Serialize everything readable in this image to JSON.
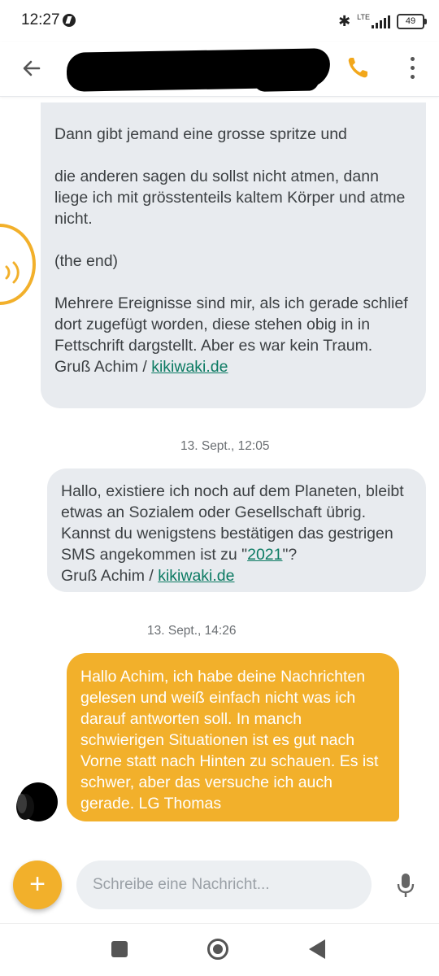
{
  "status_bar": {
    "time": "12:27",
    "network": "LTE",
    "battery": "49",
    "icons": [
      "bolt-icon",
      "bluetooth-icon",
      "signal-icon",
      "battery-icon"
    ]
  },
  "app_bar": {
    "icons": [
      "back-arrow-icon",
      "phone-icon",
      "more-vert-icon"
    ],
    "accent_color": "#f2b02b"
  },
  "messages": [
    {
      "direction": "incoming",
      "paragraphs": [
        {
          "text": "Dann gibt jemand eine grosse spritze und"
        },
        {
          "text": "die anderen sagen du sollst nicht atmen, dann liege ich mit grösstenteils kaltem Körper und atme nicht."
        },
        {
          "text": "(the end)"
        },
        {
          "text": "Mehrere Ereignisse sind mir, als ich gerade schlief dort zugefügt worden, diese stehen obig in in Fettschrift dargstellt. Aber es war kein Traum."
        }
      ],
      "signature_prefix": "Gruß Achim / ",
      "signature_link": "kikiwaki.de"
    },
    {
      "direction": "incoming",
      "timestamp": "13. Sept., 12:05",
      "text_before_link": "Hallo, existiere ich noch auf dem Planeten, bleibt etwas an Sozialem oder Gesellschaft übrig. Kannst du wenigstens bestätigen das gestrigen SMS angekommen ist zu \"",
      "inline_link": "2021",
      "text_after_link": "\"?",
      "signature_prefix": "Gruß Achim / ",
      "signature_link": "kikiwaki.de"
    },
    {
      "direction": "outgoing",
      "timestamp": "13. Sept., 14:26",
      "text": "Hallo Achim, ich habe deine Nachrichten gelesen und weiß einfach nicht was ich darauf antworten soll. In manch schwierigen Situationen ist es gut nach Vorne statt nach Hinten zu schauen. Es ist schwer, aber das versuche ich auch gerade. LG Thomas"
    }
  ],
  "composer": {
    "placeholder": "Schreibe eine Nachricht...",
    "add_label": "+",
    "icons": [
      "plus-icon",
      "mic-icon"
    ]
  },
  "nav_bar": {
    "icons": [
      "recents-square-icon",
      "home-circle-icon",
      "back-triangle-icon"
    ]
  },
  "colors": {
    "outgoing_bubble": "#f2b02b",
    "incoming_bubble": "#e8ebef",
    "link": "#0b7a62"
  }
}
